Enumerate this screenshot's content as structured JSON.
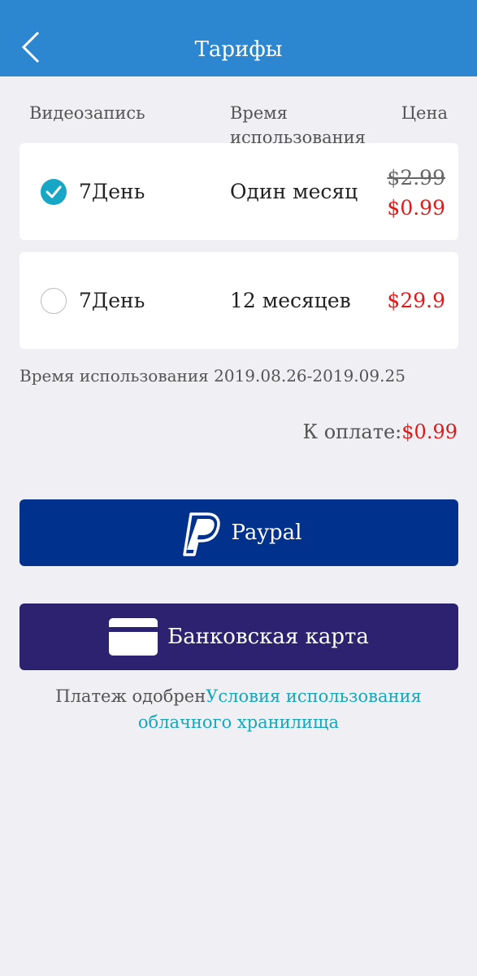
{
  "header": {
    "title": "Тарифы",
    "back_icon": "chevron-left-icon"
  },
  "columns": {
    "video": "Видеозапись",
    "time": "Время использования",
    "price": "Цена"
  },
  "plans": [
    {
      "name": "7День",
      "duration": "Один месяц",
      "old_price": "$2.99",
      "price": "$0.99",
      "selected": true
    },
    {
      "name": "7День",
      "duration": "12 месяцев",
      "price": "$29.9",
      "selected": false
    }
  ],
  "usage_period": "Время использования 2019.08.26-2019.09.25",
  "payment": {
    "label": "К оплате:",
    "amount": "$0.99"
  },
  "buttons": {
    "paypal": "Paypal",
    "bank_card": "Банковская карта"
  },
  "terms": {
    "prefix": "Платеж одобрен",
    "link": "Условия использования облачного хранилища"
  },
  "colors": {
    "header_bg": "#2d87d0",
    "accent": "#16a7c6",
    "price_red": "#e01919",
    "paypal_bg": "#00318c",
    "card_bg": "#2c226f",
    "link": "#17a7b8"
  }
}
